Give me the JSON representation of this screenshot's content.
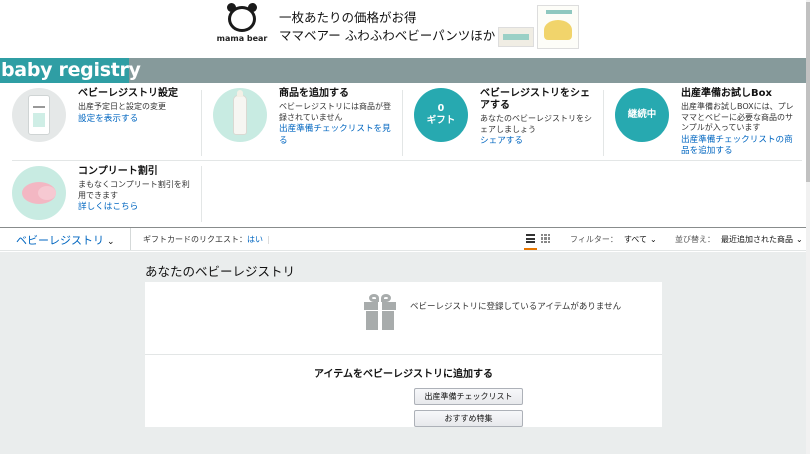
{
  "ad": {
    "brand": "mama bear",
    "line1": "一枚あたりの価格がお得",
    "line2": "ママベアー ふわふわベビーパンツほか"
  },
  "brand_bar": {
    "title": "baby registry"
  },
  "tiles": [
    {
      "title": "ベビーレジストリ設定",
      "desc": "出産予定日と設定の変更",
      "link": "設定を表示する"
    },
    {
      "title": "商品を追加する",
      "desc": "ベビーレジストリには商品が登録されていません",
      "link": "出産準備チェックリストを見る"
    },
    {
      "title": "ベビーレジストリをシェアする",
      "desc": "あなたのベビーレジストリをシェアしましょう",
      "link": "シェアする",
      "badge_count": "0",
      "badge_label": "ギフト"
    },
    {
      "title": "出産準備お試しBox",
      "desc": "出産準備お試しBOXには、プレママとベビーに必要な商品のサンプルが入っています",
      "link": "出産準備チェックリストの商品を追加する",
      "badge_label": "継続中"
    },
    {
      "title": "コンプリート割引",
      "desc": "まもなくコンプリート割引を利用できます",
      "link": "詳しくはこちら"
    }
  ],
  "toolbar": {
    "registry_label": "ベビーレジストリ",
    "gift_card_label": "ギフトカードのリクエスト：",
    "gift_card_value": "はい",
    "filter_label": "フィルター：",
    "filter_value": "すべて",
    "sort_label": "並び替え：",
    "sort_value": "最近追加された商品"
  },
  "main": {
    "section_title": "あなたのベビーレジストリ",
    "empty_message": "ベビーレジストリに登録しているアイテムがありません",
    "add_heading": "アイテムをベビーレジストリに追加する",
    "checklist_button": "出産準備チェックリスト",
    "featured_button": "おすすめ特集"
  },
  "colors": {
    "teal": "#27a9b0",
    "link": "#0066c0",
    "brand_bar": "#869a9b",
    "active_tab": "#e77600"
  }
}
